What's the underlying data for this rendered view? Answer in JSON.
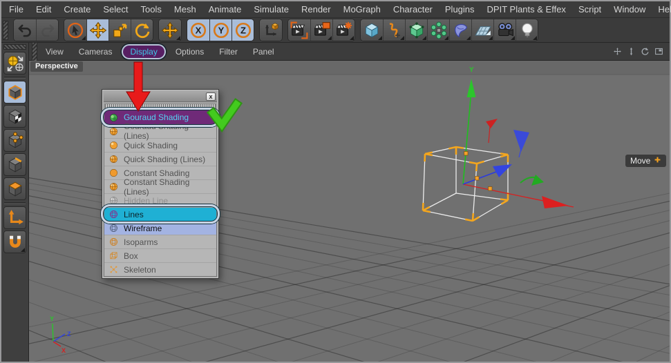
{
  "menubar": {
    "items": [
      "File",
      "Edit",
      "Create",
      "Select",
      "Tools",
      "Mesh",
      "Animate",
      "Simulate",
      "Render",
      "MoGraph",
      "Character",
      "Plugins",
      "DPIT Plants & Effex",
      "Script",
      "Window",
      "Help"
    ]
  },
  "toolbar": {
    "groups": [
      {
        "buttons": [
          {
            "name": "undo",
            "icon": "undo-icon"
          },
          {
            "name": "redo",
            "icon": "redo-icon",
            "disabled": true
          }
        ]
      },
      {
        "buttons": [
          {
            "name": "live-selection",
            "icon": "live-selection-icon",
            "submenu": true
          },
          {
            "name": "move-tool",
            "icon": "move-icon",
            "active": true
          },
          {
            "name": "scale-tool",
            "icon": "scale-icon"
          },
          {
            "name": "rotate-tool",
            "icon": "rotate-icon"
          }
        ]
      },
      {
        "buttons": [
          {
            "name": "last-used-tool",
            "icon": "last-tool-icon",
            "submenu": true
          }
        ]
      },
      {
        "buttons": [
          {
            "name": "lock-x-axis",
            "icon": "axis-letter-icon",
            "label": "X",
            "active": true
          },
          {
            "name": "lock-y-axis",
            "icon": "axis-letter-icon",
            "label": "Y",
            "active": true
          },
          {
            "name": "lock-z-axis",
            "icon": "axis-letter-icon",
            "label": "Z",
            "active": true
          }
        ]
      },
      {
        "buttons": [
          {
            "name": "coordinate-system",
            "icon": "coordinate-system-icon"
          }
        ]
      },
      {
        "buttons": [
          {
            "name": "render-view",
            "icon": "render-view-icon"
          },
          {
            "name": "render-picture-viewer",
            "icon": "render-picture-viewer-icon",
            "submenu": true
          },
          {
            "name": "render-settings",
            "icon": "render-settings-icon",
            "submenu": true
          }
        ]
      },
      {
        "buttons": [
          {
            "name": "add-cube",
            "icon": "add-cube-icon",
            "submenu": true
          },
          {
            "name": "spline-pen",
            "icon": "spline-pen-icon",
            "submenu": true
          },
          {
            "name": "subdivision-surface",
            "icon": "subdivision-surface-icon",
            "submenu": true
          },
          {
            "name": "array-object",
            "icon": "array-icon",
            "submenu": true
          },
          {
            "name": "deformer",
            "icon": "deformer-icon",
            "submenu": true
          },
          {
            "name": "floor-object",
            "icon": "floor-icon",
            "submenu": true
          },
          {
            "name": "camera-object",
            "icon": "camera-icon",
            "submenu": true
          },
          {
            "name": "light-object",
            "icon": "light-icon",
            "submenu": true
          }
        ]
      }
    ]
  },
  "sidebar": {
    "buttons": [
      {
        "name": "make-editable",
        "icon": "make-editable-icon"
      },
      {
        "name": "model-mode",
        "icon": "model-mode-icon",
        "active": true,
        "sepBefore": true
      },
      {
        "name": "texture-mode",
        "icon": "texture-mode-icon"
      },
      {
        "name": "point-mode",
        "icon": "point-mode-icon"
      },
      {
        "name": "edge-mode",
        "icon": "edge-mode-icon"
      },
      {
        "name": "polygon-mode",
        "icon": "polygon-mode-icon"
      },
      {
        "name": "axis-mode",
        "icon": "axis-mode-icon",
        "sepBefore": true
      },
      {
        "name": "snap",
        "icon": "snap-icon",
        "submenu": true
      }
    ]
  },
  "viewport_menubar": {
    "items": [
      {
        "label": "View"
      },
      {
        "label": "Cameras"
      },
      {
        "label": "Display",
        "active": true
      },
      {
        "label": "Options"
      },
      {
        "label": "Filter"
      },
      {
        "label": "Panel"
      }
    ],
    "nav_icons": [
      "pan-view-icon",
      "zoom-view-icon",
      "rotate-view-icon",
      "toggle-view-icon"
    ]
  },
  "viewport": {
    "camera_label": "Perspective",
    "tool_hint_label": "Move",
    "tool_hint_icon": "plus-icon",
    "gizmo_y_label": "Y",
    "axis_triad": {
      "x": "X",
      "y": "Y",
      "z": "Z"
    }
  },
  "display_menu": {
    "close_glyph": "x",
    "items": [
      {
        "label": "Gouraud Shading",
        "icon": "gouraud-sphere-icon",
        "state": "highlighted-purple",
        "ring": true
      },
      {
        "label": "Gouraud Shading (Lines)",
        "icon": "sphere-lines-icon"
      },
      {
        "label": "Quick Shading",
        "icon": "sphere-icon"
      },
      {
        "label": "Quick Shading (Lines)",
        "icon": "sphere-lines-icon"
      },
      {
        "label": "Constant Shading",
        "icon": "flat-sphere-icon"
      },
      {
        "label": "Constant Shading (Lines)",
        "icon": "sphere-lines-icon"
      },
      {
        "label": "Hidden Line",
        "icon": "gray-sphere-icon",
        "disabled": true
      },
      {
        "label": "Lines",
        "icon": "wire-globe-purple-icon",
        "state": "highlighted-cyan",
        "ring": true
      },
      {
        "label": "Wireframe",
        "icon": "wire-globe-icon",
        "state": "current",
        "separatorBefore": true
      },
      {
        "label": "Isoparms",
        "icon": "wire-globe-orange-icon"
      },
      {
        "label": "Box",
        "icon": "wire-box-icon"
      },
      {
        "label": "Skeleton",
        "icon": "skeleton-icon"
      }
    ]
  },
  "annotations": {
    "items": [
      {
        "icon": "red-arrow-icon",
        "color": "#e81a1a"
      },
      {
        "icon": "green-check-icon",
        "color": "#43cb1e"
      }
    ]
  },
  "colors": {
    "bar_bg": "#3b3b3b",
    "button_active_blue": "#a9bdd9",
    "accent_orange": "#f2a020",
    "display_pill_bg": "#571f63",
    "display_pill_text": "#3fc8e8",
    "menu_highlight_purple": "#6f2a78",
    "menu_highlight_cyan": "#1fb0d4",
    "menu_current_blue": "#a3b3e2",
    "viewport_gray": "#707070",
    "axis_x": "#d42222",
    "axis_y": "#2cc52c",
    "axis_z": "#3344e0"
  }
}
